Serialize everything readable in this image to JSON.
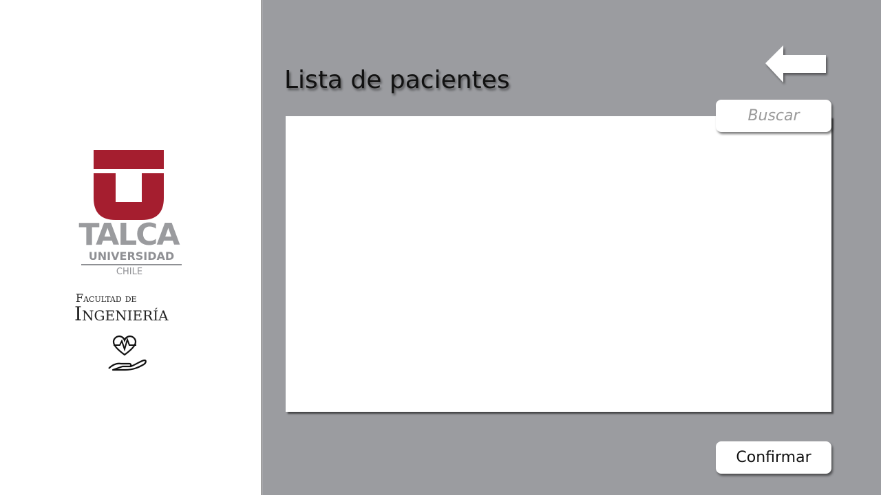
{
  "sidebar": {
    "logo": {
      "brand_color": "#a51e2f",
      "name": "TALCA",
      "subtitle": "UNIVERSIDAD",
      "country": "CHILE"
    },
    "faculty": {
      "line1": "Facultad de",
      "line2": "Ingeniería"
    },
    "care_icon": "heart-hand-icon"
  },
  "main": {
    "title": "Lista de pacientes",
    "back_icon": "back-arrow-icon",
    "search": {
      "placeholder": "Buscar",
      "value": ""
    },
    "patients": [],
    "confirm_label": "Confirmar",
    "background_color": "#9b9ca0"
  }
}
